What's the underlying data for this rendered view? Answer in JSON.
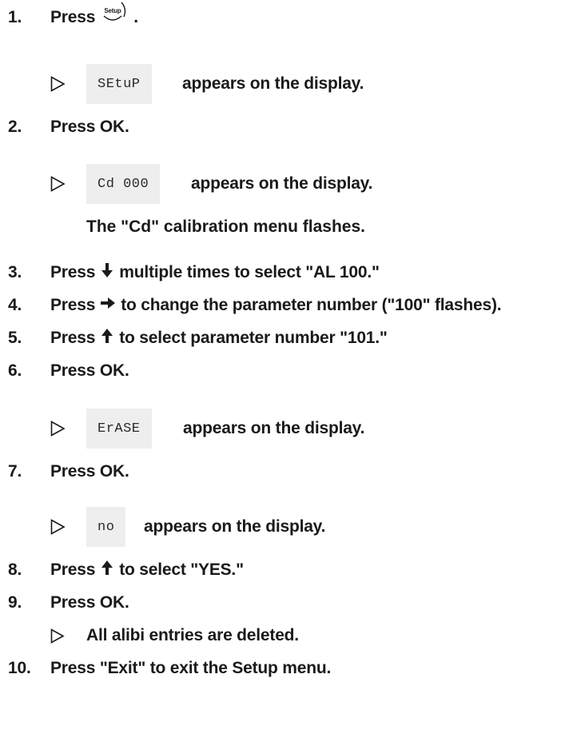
{
  "steps": [
    {
      "n": "1.",
      "before": "Press",
      "after": "."
    },
    {
      "n": "2.",
      "text": "Press OK."
    },
    {
      "n": "3.",
      "before": "Press",
      "after": "multiple times to select \"AL 100.\""
    },
    {
      "n": "4.",
      "before": "Press",
      "after": "to change the parameter number (\"100\" flashes)."
    },
    {
      "n": "5.",
      "before": "Press",
      "after": "to select parameter number \"101.\""
    },
    {
      "n": "6.",
      "text": "Press OK."
    },
    {
      "n": "7.",
      "text": "Press OK."
    },
    {
      "n": "8.",
      "before": "Press",
      "after": "to select \"YES.\""
    },
    {
      "n": "9.",
      "text": "Press OK."
    },
    {
      "n": "10.",
      "text": "Press \"Exit\" to exit the Setup menu."
    }
  ],
  "setup_key_label": "Setup",
  "results": [
    {
      "display": "SEtuP",
      "text": "appears on the display."
    },
    {
      "display": "Cd 000",
      "text": "appears on the display."
    },
    {
      "display": "ErASE",
      "text": "appears on the display."
    },
    {
      "display": "no",
      "text": "appears on the display."
    }
  ],
  "note_cd": "The \"Cd\" calibration menu flashes.",
  "result_9": "All alibi entries are deleted.",
  "icons": {
    "result": "triangle-right-outline-icon",
    "setup": "setup-key-icon",
    "down": "arrow-down-icon",
    "right": "arrow-right-icon",
    "up": "arrow-up-icon"
  }
}
